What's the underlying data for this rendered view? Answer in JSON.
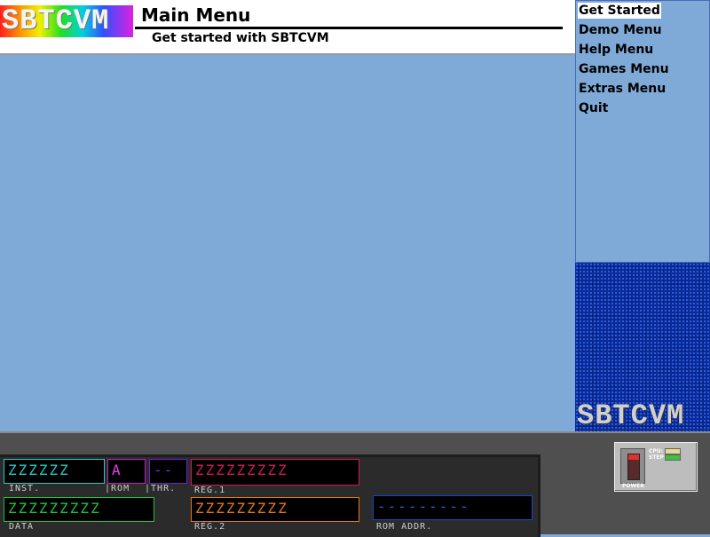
{
  "header": {
    "logo_text": "SBTCVM",
    "title": "Main Menu",
    "subtitle": "Get started with SBTCVM"
  },
  "menu": {
    "items": [
      {
        "label": "Get Started",
        "selected": true
      },
      {
        "label": "Demo Menu",
        "selected": false
      },
      {
        "label": "Help Menu",
        "selected": false
      },
      {
        "label": "Games Menu",
        "selected": false
      },
      {
        "label": "Extras Menu",
        "selected": false
      },
      {
        "label": "Quit",
        "selected": false
      }
    ]
  },
  "brand_panel": {
    "text": "SBTCVM"
  },
  "console": {
    "inst": {
      "value": "ΖΖΖΖΖΖ",
      "label": "INST."
    },
    "rom": {
      "value": "A",
      "label": "ROM"
    },
    "thr": {
      "value": "--",
      "label": "THR."
    },
    "reg1": {
      "value": "ΖΖΖΖΖΖΖΖΖ",
      "label": "REG.1"
    },
    "data": {
      "value": "ΖΖΖΖΖΖΖΖΖ",
      "label": "DATA"
    },
    "reg2": {
      "value": "ΖΖΖΖΖΖΖΖΖ",
      "label": "REG.2"
    },
    "rom_addr": {
      "value": "---------",
      "label": "ROM ADDR."
    }
  },
  "power": {
    "label": "POWER",
    "cpu_label": "CPU:",
    "step_label": "STEP:"
  },
  "colors": {
    "workspace": "#7faad8",
    "menu_selected_bg": "#ffffff",
    "inst": "#28c8c8",
    "rom": "#c020c0",
    "thr": "#7020d0",
    "reg1": "#d01a5a",
    "data": "#20c040",
    "reg2": "#e07818",
    "rom_addr": "#1848c8",
    "cpu_indicator": "#e8d890",
    "step_indicator": "#40c040"
  }
}
